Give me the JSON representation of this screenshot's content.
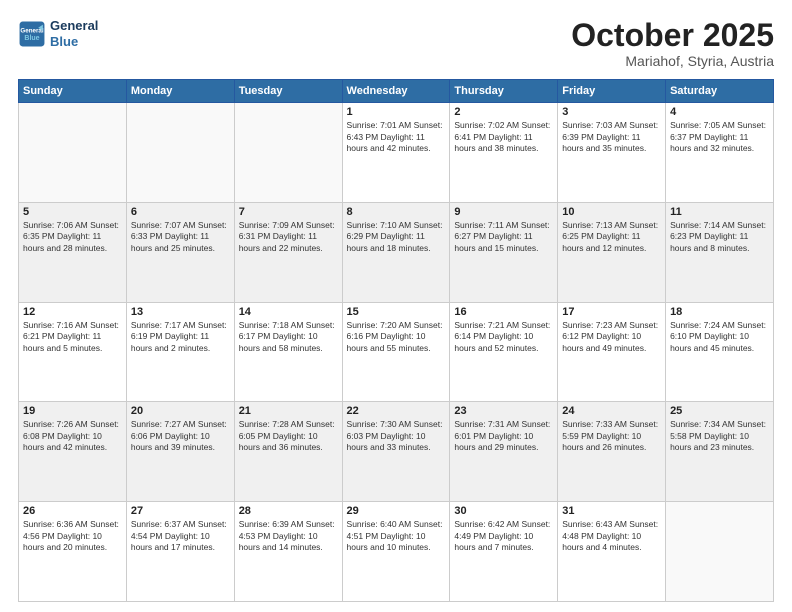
{
  "header": {
    "logo_line1": "General",
    "logo_line2": "Blue",
    "month": "October 2025",
    "location": "Mariahof, Styria, Austria"
  },
  "weekdays": [
    "Sunday",
    "Monday",
    "Tuesday",
    "Wednesday",
    "Thursday",
    "Friday",
    "Saturday"
  ],
  "weeks": [
    [
      {
        "day": "",
        "info": ""
      },
      {
        "day": "",
        "info": ""
      },
      {
        "day": "",
        "info": ""
      },
      {
        "day": "1",
        "info": "Sunrise: 7:01 AM\nSunset: 6:43 PM\nDaylight: 11 hours\nand 42 minutes."
      },
      {
        "day": "2",
        "info": "Sunrise: 7:02 AM\nSunset: 6:41 PM\nDaylight: 11 hours\nand 38 minutes."
      },
      {
        "day": "3",
        "info": "Sunrise: 7:03 AM\nSunset: 6:39 PM\nDaylight: 11 hours\nand 35 minutes."
      },
      {
        "day": "4",
        "info": "Sunrise: 7:05 AM\nSunset: 6:37 PM\nDaylight: 11 hours\nand 32 minutes."
      }
    ],
    [
      {
        "day": "5",
        "info": "Sunrise: 7:06 AM\nSunset: 6:35 PM\nDaylight: 11 hours\nand 28 minutes."
      },
      {
        "day": "6",
        "info": "Sunrise: 7:07 AM\nSunset: 6:33 PM\nDaylight: 11 hours\nand 25 minutes."
      },
      {
        "day": "7",
        "info": "Sunrise: 7:09 AM\nSunset: 6:31 PM\nDaylight: 11 hours\nand 22 minutes."
      },
      {
        "day": "8",
        "info": "Sunrise: 7:10 AM\nSunset: 6:29 PM\nDaylight: 11 hours\nand 18 minutes."
      },
      {
        "day": "9",
        "info": "Sunrise: 7:11 AM\nSunset: 6:27 PM\nDaylight: 11 hours\nand 15 minutes."
      },
      {
        "day": "10",
        "info": "Sunrise: 7:13 AM\nSunset: 6:25 PM\nDaylight: 11 hours\nand 12 minutes."
      },
      {
        "day": "11",
        "info": "Sunrise: 7:14 AM\nSunset: 6:23 PM\nDaylight: 11 hours\nand 8 minutes."
      }
    ],
    [
      {
        "day": "12",
        "info": "Sunrise: 7:16 AM\nSunset: 6:21 PM\nDaylight: 11 hours\nand 5 minutes."
      },
      {
        "day": "13",
        "info": "Sunrise: 7:17 AM\nSunset: 6:19 PM\nDaylight: 11 hours\nand 2 minutes."
      },
      {
        "day": "14",
        "info": "Sunrise: 7:18 AM\nSunset: 6:17 PM\nDaylight: 10 hours\nand 58 minutes."
      },
      {
        "day": "15",
        "info": "Sunrise: 7:20 AM\nSunset: 6:16 PM\nDaylight: 10 hours\nand 55 minutes."
      },
      {
        "day": "16",
        "info": "Sunrise: 7:21 AM\nSunset: 6:14 PM\nDaylight: 10 hours\nand 52 minutes."
      },
      {
        "day": "17",
        "info": "Sunrise: 7:23 AM\nSunset: 6:12 PM\nDaylight: 10 hours\nand 49 minutes."
      },
      {
        "day": "18",
        "info": "Sunrise: 7:24 AM\nSunset: 6:10 PM\nDaylight: 10 hours\nand 45 minutes."
      }
    ],
    [
      {
        "day": "19",
        "info": "Sunrise: 7:26 AM\nSunset: 6:08 PM\nDaylight: 10 hours\nand 42 minutes."
      },
      {
        "day": "20",
        "info": "Sunrise: 7:27 AM\nSunset: 6:06 PM\nDaylight: 10 hours\nand 39 minutes."
      },
      {
        "day": "21",
        "info": "Sunrise: 7:28 AM\nSunset: 6:05 PM\nDaylight: 10 hours\nand 36 minutes."
      },
      {
        "day": "22",
        "info": "Sunrise: 7:30 AM\nSunset: 6:03 PM\nDaylight: 10 hours\nand 33 minutes."
      },
      {
        "day": "23",
        "info": "Sunrise: 7:31 AM\nSunset: 6:01 PM\nDaylight: 10 hours\nand 29 minutes."
      },
      {
        "day": "24",
        "info": "Sunrise: 7:33 AM\nSunset: 5:59 PM\nDaylight: 10 hours\nand 26 minutes."
      },
      {
        "day": "25",
        "info": "Sunrise: 7:34 AM\nSunset: 5:58 PM\nDaylight: 10 hours\nand 23 minutes."
      }
    ],
    [
      {
        "day": "26",
        "info": "Sunrise: 6:36 AM\nSunset: 4:56 PM\nDaylight: 10 hours\nand 20 minutes."
      },
      {
        "day": "27",
        "info": "Sunrise: 6:37 AM\nSunset: 4:54 PM\nDaylight: 10 hours\nand 17 minutes."
      },
      {
        "day": "28",
        "info": "Sunrise: 6:39 AM\nSunset: 4:53 PM\nDaylight: 10 hours\nand 14 minutes."
      },
      {
        "day": "29",
        "info": "Sunrise: 6:40 AM\nSunset: 4:51 PM\nDaylight: 10 hours\nand 10 minutes."
      },
      {
        "day": "30",
        "info": "Sunrise: 6:42 AM\nSunset: 4:49 PM\nDaylight: 10 hours\nand 7 minutes."
      },
      {
        "day": "31",
        "info": "Sunrise: 6:43 AM\nSunset: 4:48 PM\nDaylight: 10 hours\nand 4 minutes."
      },
      {
        "day": "",
        "info": ""
      }
    ]
  ]
}
